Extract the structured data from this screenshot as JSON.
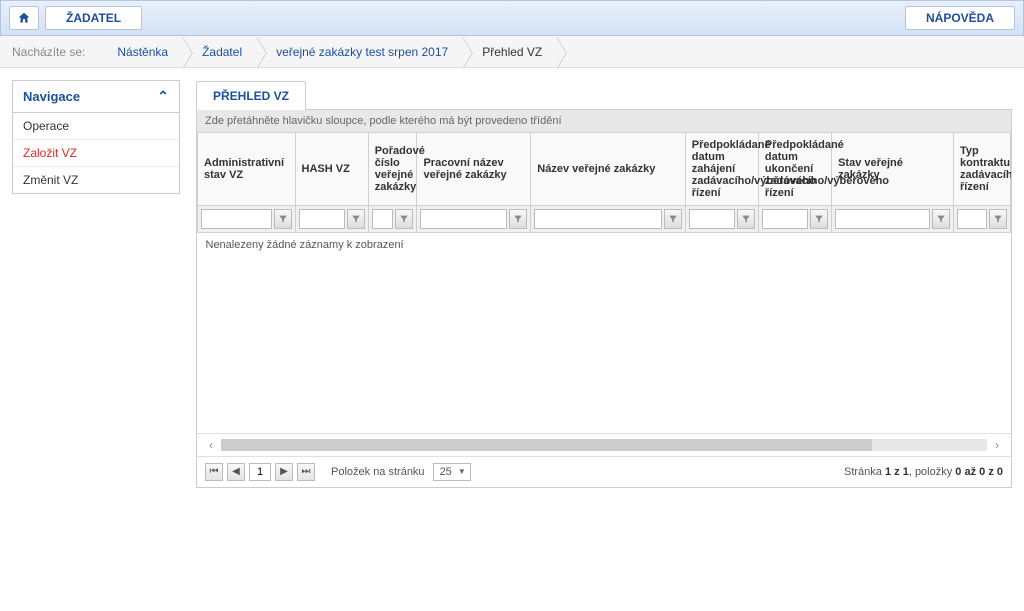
{
  "topbar": {
    "zadatel_btn": "ŽADATEL",
    "napoveda_btn": "NÁPOVĚDA"
  },
  "breadcrumb": {
    "label": "Nacházíte se:",
    "items": [
      "Nástěnka",
      "Žadatel",
      "veřejné zakázky test srpen 2017",
      "Přehled VZ"
    ]
  },
  "sidebar": {
    "title": "Navigace",
    "items": [
      {
        "label": "Operace",
        "highlight": false
      },
      {
        "label": "Založit VZ",
        "highlight": true
      },
      {
        "label": "Změnit VZ",
        "highlight": false
      }
    ]
  },
  "tab_label": "PŘEHLED VZ",
  "grid": {
    "group_hint": "Zde přetáhněte hlavičku sloupce, podle kterého má být provedeno třídění",
    "columns": [
      "Administrativní stav VZ",
      "HASH VZ",
      "Pořadové číslo veřejné zakázky",
      "Pracovní název veřejné zakázky",
      "Název veřejné zakázky",
      "Předpokládané datum zahájení zadávacího/výběrového řízení",
      "Předpokládané datum ukončení zadávacího/výběrového řízení",
      "Stav veřejné zakázky",
      "Typ kontraktu zadávacího řízení"
    ],
    "empty_text": "Nenalezeny žádné záznamy k zobrazení"
  },
  "pager": {
    "current_page": "1",
    "per_page_label": "Položek na stránku",
    "per_page_value": "25",
    "info_prefix": "Stránka ",
    "info_pages": "1 z 1",
    "info_mid": ", položky ",
    "info_range": "0 až 0 z 0"
  }
}
